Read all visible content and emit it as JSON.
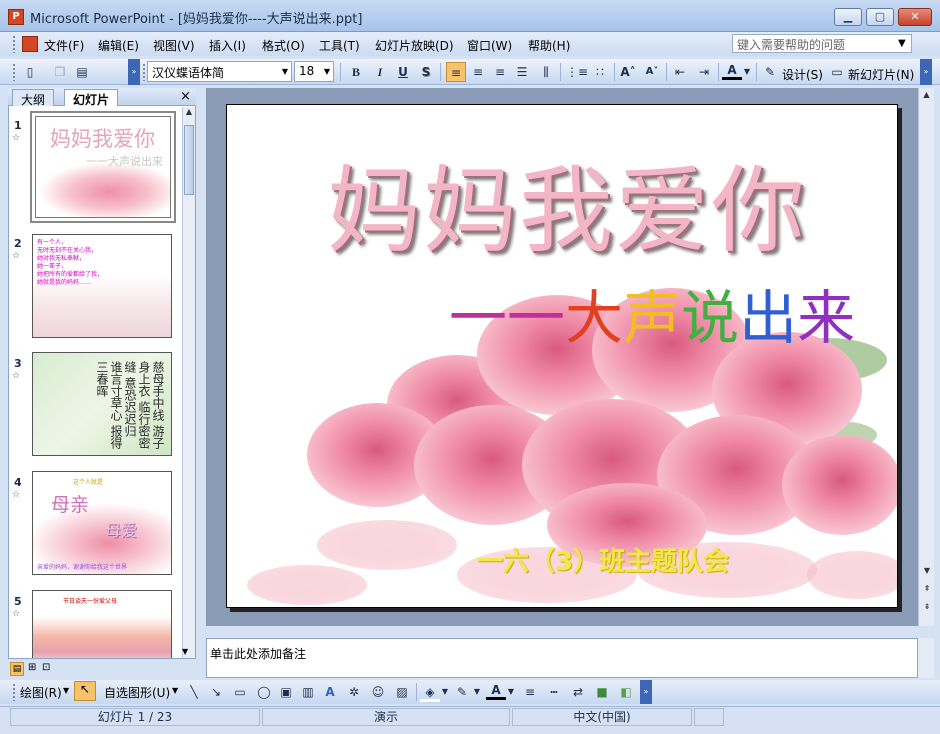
{
  "window": {
    "title": "Microsoft PowerPoint - [妈妈我爱你----大声说出来.ppt]",
    "app_icon": "P"
  },
  "menu": {
    "items": [
      {
        "label": "文件(F)"
      },
      {
        "label": "编辑(E)"
      },
      {
        "label": "视图(V)"
      },
      {
        "label": "插入(I)"
      },
      {
        "label": "格式(O)"
      },
      {
        "label": "工具(T)"
      },
      {
        "label": "幻灯片放映(D)"
      },
      {
        "label": "窗口(W)"
      },
      {
        "label": "帮助(H)"
      }
    ],
    "help_placeholder": "键入需要帮助的问题"
  },
  "toolbar": {
    "font": "汉仪蝶语体简",
    "size": "18",
    "bold": "B",
    "italic": "I",
    "underline": "U",
    "shadow": "S",
    "design_label": "设计(S)",
    "new_slide_label": "新幻灯片(N)"
  },
  "pane": {
    "tab_outline": "大纲",
    "tab_slides": "幻灯片",
    "close": "×",
    "thumbnails": [
      {
        "num": "1",
        "title": "妈妈我爱你",
        "sub": "一一大声说出来"
      },
      {
        "num": "2",
        "lines": [
          "有一个人，",
          "无时无刻不在关心我，",
          "她对我无私奉献，",
          "她一辈子，",
          "她把所有的爱都给了我，",
          "她就是我的妈妈……"
        ]
      },
      {
        "num": "3",
        "calligraphy": "慈母手中线 游子身上衣 临行密密缝 意恐迟迟归 谁言寸草心 报得三春晖"
      },
      {
        "num": "4",
        "word1": "母亲",
        "word2": "母爱",
        "top": "这个人就是",
        "caption": "亲爱的妈妈，谢谢你给我这个世界"
      },
      {
        "num": "5",
        "heading": "节日谈天一份爱父母"
      }
    ]
  },
  "slide": {
    "title": "妈妈我爱你",
    "subtitle_dash": "一一",
    "subtitle_chars": [
      "大",
      "声",
      "说",
      "出",
      "来"
    ],
    "subtitle_colors": [
      "#e04020",
      "#f0c020",
      "#40b040",
      "#3060d0",
      "#9030c0"
    ],
    "footer": "一六（3）班主题队会"
  },
  "notes": {
    "placeholder": "单击此处添加备注"
  },
  "drawbar": {
    "draw_label": "绘图(R)",
    "autoshape_label": "自选图形(U)"
  },
  "status": {
    "slide": "幻灯片 1 / 23",
    "design": "演示",
    "language": "中文(中国)"
  }
}
